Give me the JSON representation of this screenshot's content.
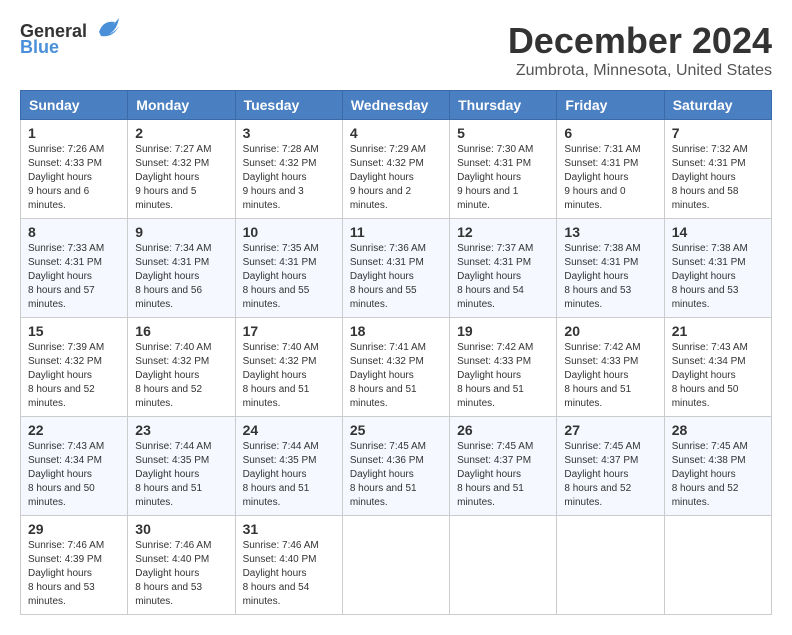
{
  "logo": {
    "line1": "General",
    "line2": "Blue"
  },
  "title": "December 2024",
  "subtitle": "Zumbrota, Minnesota, United States",
  "days_of_week": [
    "Sunday",
    "Monday",
    "Tuesday",
    "Wednesday",
    "Thursday",
    "Friday",
    "Saturday"
  ],
  "weeks": [
    [
      {
        "day": "1",
        "sunrise": "7:26 AM",
        "sunset": "4:33 PM",
        "daylight": "9 hours and 6 minutes."
      },
      {
        "day": "2",
        "sunrise": "7:27 AM",
        "sunset": "4:32 PM",
        "daylight": "9 hours and 5 minutes."
      },
      {
        "day": "3",
        "sunrise": "7:28 AM",
        "sunset": "4:32 PM",
        "daylight": "9 hours and 3 minutes."
      },
      {
        "day": "4",
        "sunrise": "7:29 AM",
        "sunset": "4:32 PM",
        "daylight": "9 hours and 2 minutes."
      },
      {
        "day": "5",
        "sunrise": "7:30 AM",
        "sunset": "4:31 PM",
        "daylight": "9 hours and 1 minute."
      },
      {
        "day": "6",
        "sunrise": "7:31 AM",
        "sunset": "4:31 PM",
        "daylight": "9 hours and 0 minutes."
      },
      {
        "day": "7",
        "sunrise": "7:32 AM",
        "sunset": "4:31 PM",
        "daylight": "8 hours and 58 minutes."
      }
    ],
    [
      {
        "day": "8",
        "sunrise": "7:33 AM",
        "sunset": "4:31 PM",
        "daylight": "8 hours and 57 minutes."
      },
      {
        "day": "9",
        "sunrise": "7:34 AM",
        "sunset": "4:31 PM",
        "daylight": "8 hours and 56 minutes."
      },
      {
        "day": "10",
        "sunrise": "7:35 AM",
        "sunset": "4:31 PM",
        "daylight": "8 hours and 55 minutes."
      },
      {
        "day": "11",
        "sunrise": "7:36 AM",
        "sunset": "4:31 PM",
        "daylight": "8 hours and 55 minutes."
      },
      {
        "day": "12",
        "sunrise": "7:37 AM",
        "sunset": "4:31 PM",
        "daylight": "8 hours and 54 minutes."
      },
      {
        "day": "13",
        "sunrise": "7:38 AM",
        "sunset": "4:31 PM",
        "daylight": "8 hours and 53 minutes."
      },
      {
        "day": "14",
        "sunrise": "7:38 AM",
        "sunset": "4:31 PM",
        "daylight": "8 hours and 53 minutes."
      }
    ],
    [
      {
        "day": "15",
        "sunrise": "7:39 AM",
        "sunset": "4:32 PM",
        "daylight": "8 hours and 52 minutes."
      },
      {
        "day": "16",
        "sunrise": "7:40 AM",
        "sunset": "4:32 PM",
        "daylight": "8 hours and 52 minutes."
      },
      {
        "day": "17",
        "sunrise": "7:40 AM",
        "sunset": "4:32 PM",
        "daylight": "8 hours and 51 minutes."
      },
      {
        "day": "18",
        "sunrise": "7:41 AM",
        "sunset": "4:32 PM",
        "daylight": "8 hours and 51 minutes."
      },
      {
        "day": "19",
        "sunrise": "7:42 AM",
        "sunset": "4:33 PM",
        "daylight": "8 hours and 51 minutes."
      },
      {
        "day": "20",
        "sunrise": "7:42 AM",
        "sunset": "4:33 PM",
        "daylight": "8 hours and 51 minutes."
      },
      {
        "day": "21",
        "sunrise": "7:43 AM",
        "sunset": "4:34 PM",
        "daylight": "8 hours and 50 minutes."
      }
    ],
    [
      {
        "day": "22",
        "sunrise": "7:43 AM",
        "sunset": "4:34 PM",
        "daylight": "8 hours and 50 minutes."
      },
      {
        "day": "23",
        "sunrise": "7:44 AM",
        "sunset": "4:35 PM",
        "daylight": "8 hours and 51 minutes."
      },
      {
        "day": "24",
        "sunrise": "7:44 AM",
        "sunset": "4:35 PM",
        "daylight": "8 hours and 51 minutes."
      },
      {
        "day": "25",
        "sunrise": "7:45 AM",
        "sunset": "4:36 PM",
        "daylight": "8 hours and 51 minutes."
      },
      {
        "day": "26",
        "sunrise": "7:45 AM",
        "sunset": "4:37 PM",
        "daylight": "8 hours and 51 minutes."
      },
      {
        "day": "27",
        "sunrise": "7:45 AM",
        "sunset": "4:37 PM",
        "daylight": "8 hours and 52 minutes."
      },
      {
        "day": "28",
        "sunrise": "7:45 AM",
        "sunset": "4:38 PM",
        "daylight": "8 hours and 52 minutes."
      }
    ],
    [
      {
        "day": "29",
        "sunrise": "7:46 AM",
        "sunset": "4:39 PM",
        "daylight": "8 hours and 53 minutes."
      },
      {
        "day": "30",
        "sunrise": "7:46 AM",
        "sunset": "4:40 PM",
        "daylight": "8 hours and 53 minutes."
      },
      {
        "day": "31",
        "sunrise": "7:46 AM",
        "sunset": "4:40 PM",
        "daylight": "8 hours and 54 minutes."
      },
      null,
      null,
      null,
      null
    ]
  ],
  "labels": {
    "sunrise": "Sunrise:",
    "sunset": "Sunset:",
    "daylight": "Daylight:"
  }
}
